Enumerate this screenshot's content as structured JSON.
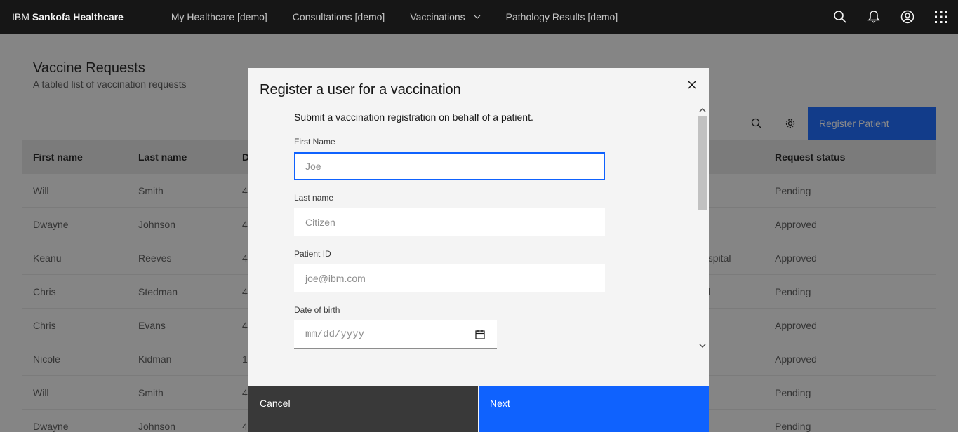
{
  "header": {
    "brand_prefix": "IBM",
    "brand_name": "Sankofa Healthcare",
    "nav": [
      {
        "label": "My Healthcare [demo]"
      },
      {
        "label": "Consultations [demo]"
      },
      {
        "label": "Vaccinations"
      },
      {
        "label": "Pathology Results [demo]"
      }
    ],
    "actions": [
      "search-icon",
      "notification-icon",
      "user-avatar-icon",
      "app-switcher-icon"
    ]
  },
  "page": {
    "title": "Vaccine Requests",
    "subtitle": "A tabled list of vaccination requests",
    "register_button": "Register Patient"
  },
  "table": {
    "headers": {
      "first": "First name",
      "last": "Last name",
      "d": "D",
      "status": "Request status"
    },
    "rows": [
      {
        "first": "Will",
        "last": "Smith",
        "d": "4",
        "site": "",
        "status": "Pending"
      },
      {
        "first": "Dwayne",
        "last": "Johnson",
        "d": "4",
        "site": "",
        "status": "Approved"
      },
      {
        "first": "Keanu",
        "last": "Reeves",
        "d": "4",
        "site": "ospital",
        "status": "Approved"
      },
      {
        "first": "Chris",
        "last": "Stedman",
        "d": "4",
        "site": "al",
        "status": "Pending"
      },
      {
        "first": "Chris",
        "last": "Evans",
        "d": "4",
        "site": "",
        "status": "Approved"
      },
      {
        "first": "Nicole",
        "last": "Kidman",
        "d": "1",
        "site": "",
        "status": "Approved"
      },
      {
        "first": "Will",
        "last": "Smith",
        "d": "4",
        "site": "",
        "status": "Pending"
      },
      {
        "first": "Dwayne",
        "last": "Johnson",
        "d": "4",
        "site": "",
        "status": "Pending"
      }
    ]
  },
  "modal": {
    "title": "Register a user for a vaccination",
    "description": "Submit a vaccination registration on behalf of a patient.",
    "fields": {
      "first_name": {
        "label": "First Name",
        "placeholder": "Joe"
      },
      "last_name": {
        "label": "Last name",
        "placeholder": "Citizen"
      },
      "patient_id": {
        "label": "Patient ID",
        "placeholder": "joe@ibm.com"
      },
      "dob": {
        "label": "Date of birth",
        "placeholder": "mm/dd/yyyy"
      }
    },
    "cancel_label": "Cancel",
    "next_label": "Next"
  },
  "colors": {
    "primary": "#0f62fe",
    "header_bg": "#161616",
    "secondary_btn": "#393939"
  }
}
